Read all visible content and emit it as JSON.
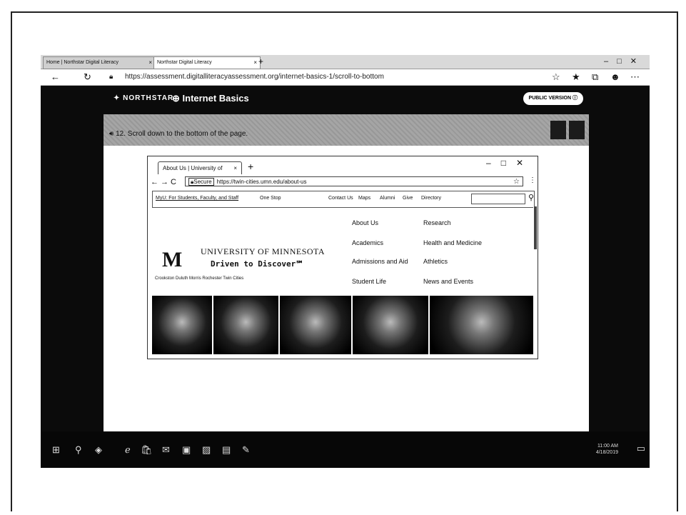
{
  "edge": {
    "tabs": [
      {
        "label": "Home | Northstar Digital Literacy"
      },
      {
        "label": "Northstar Digital Literacy"
      }
    ],
    "new_tab": "+",
    "window_controls": "–□✕",
    "url": "https://assessment.digitalliteracyassessment.org/internet-basics-1/scroll-to-bottom"
  },
  "northstar": {
    "logo": "NORTHSTAR",
    "course": "Internet Basics",
    "public_version": "PUBLIC VERSION"
  },
  "task": {
    "text": "12. Scroll down to the bottom of the page."
  },
  "chrome": {
    "tab_label": "About Us | University of",
    "tab_close": "×",
    "new_tab": "+",
    "window_controls": "–□✕",
    "secure_label": "Secure",
    "url": "https://twin-cities.umn.edu/about-us",
    "links_bar": [
      "MyU: For Students, Faculty, and Staff",
      "One Stop",
      "Contact Us",
      "Maps",
      "Alumni",
      "Give",
      "Directory"
    ]
  },
  "umn": {
    "logo_letter": "M",
    "name": "UNIVERSITY OF MINNESOTA",
    "tagline": "Driven to Discover℠",
    "campuses": "Crookston  Duluth  Morris  Rochester  Twin Cities",
    "nav_left": [
      "About Us",
      "Academics",
      "Admissions and Aid",
      "Student Life"
    ],
    "nav_right": [
      "Research",
      "Health and Medicine",
      "Athletics",
      "News and Events"
    ]
  },
  "footer": {
    "id": "1009/1109/2/W"
  },
  "taskbar": {
    "time": "11:00 AM",
    "date": "4/18/2019"
  }
}
